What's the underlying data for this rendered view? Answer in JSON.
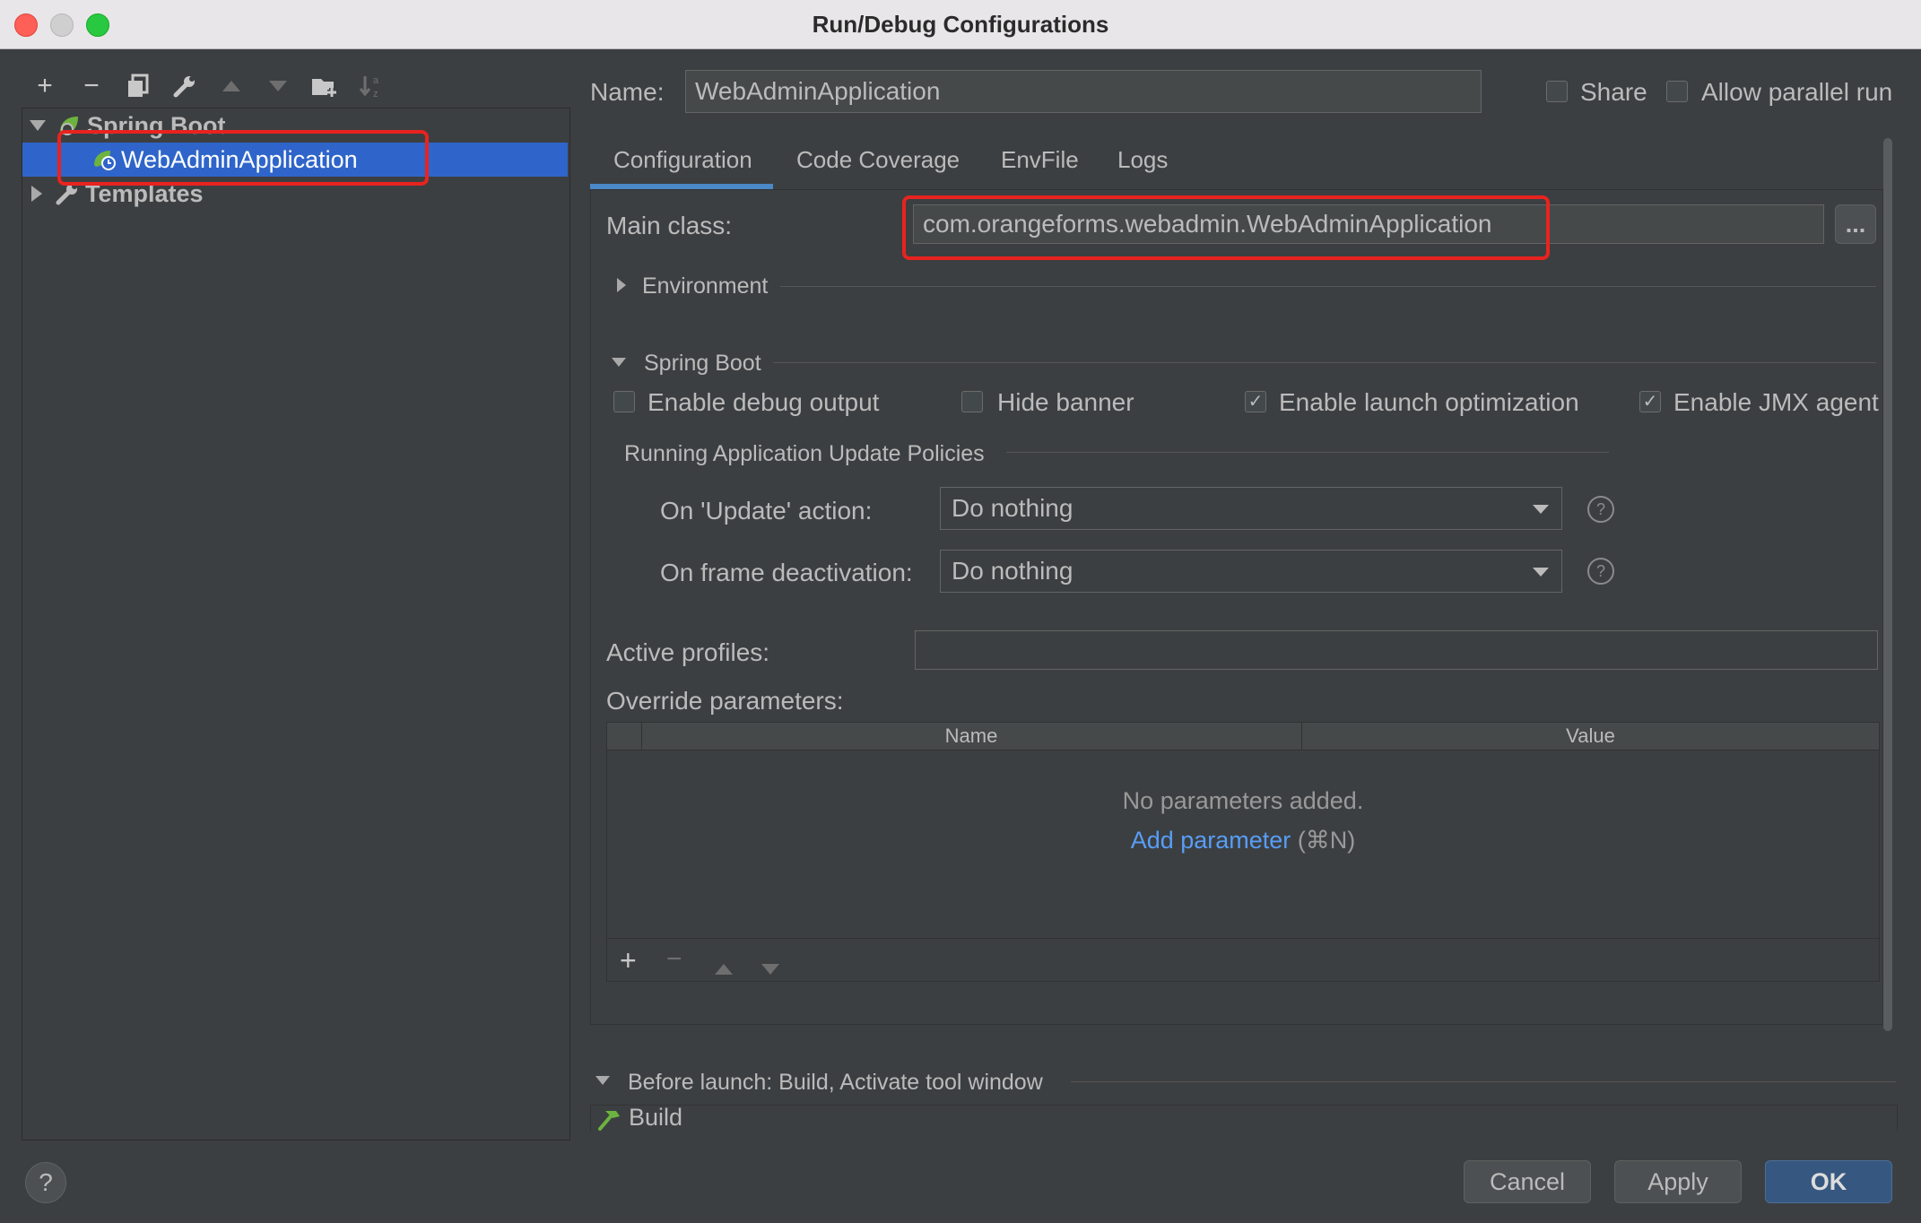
{
  "window": {
    "title": "Run/Debug Configurations"
  },
  "tree": {
    "group_label": "Spring Boot",
    "selected_item": "WebAdminApplication",
    "templates_label": "Templates"
  },
  "header": {
    "name_label": "Name:",
    "name_value": "WebAdminApplication",
    "share_label": "Share",
    "allow_parallel_label": "Allow parallel run"
  },
  "tabs": [
    {
      "label": "Configuration"
    },
    {
      "label": "Code Coverage"
    },
    {
      "label": "EnvFile"
    },
    {
      "label": "Logs"
    }
  ],
  "config": {
    "main_class_label": "Main class:",
    "main_class_value": "com.orangeforms.webadmin.WebAdminApplication",
    "browse_label": "...",
    "environment_label": "Environment",
    "spring_boot_label": "Spring Boot",
    "checkboxes": [
      {
        "label": "Enable debug output",
        "checked": false
      },
      {
        "label": "Hide banner",
        "checked": false
      },
      {
        "label": "Enable launch optimization",
        "checked": true
      },
      {
        "label": "Enable JMX agent",
        "checked": true
      }
    ],
    "policies_label": "Running Application Update Policies",
    "update_action_label": "On 'Update' action:",
    "update_action_value": "Do nothing",
    "frame_deactivation_label": "On frame deactivation:",
    "frame_deactivation_value": "Do nothing",
    "active_profiles_label": "Active profiles:",
    "active_profiles_value": "",
    "override_label": "Override parameters:",
    "table_columns": [
      "Name",
      "Value"
    ],
    "empty_text": "No parameters added.",
    "add_parameter_link": "Add parameter",
    "add_parameter_shortcut": "(⌘N)"
  },
  "before_launch": {
    "label": "Before launch: Build, Activate tool window",
    "item": "Build"
  },
  "buttons": {
    "cancel": "Cancel",
    "apply": "Apply",
    "ok": "OK",
    "help": "?"
  },
  "colors": {
    "accent": "#4a88c7",
    "selection": "#2f65ca",
    "link": "#589df6",
    "highlight": "#e8231f",
    "spring_green": "#6db33f"
  }
}
